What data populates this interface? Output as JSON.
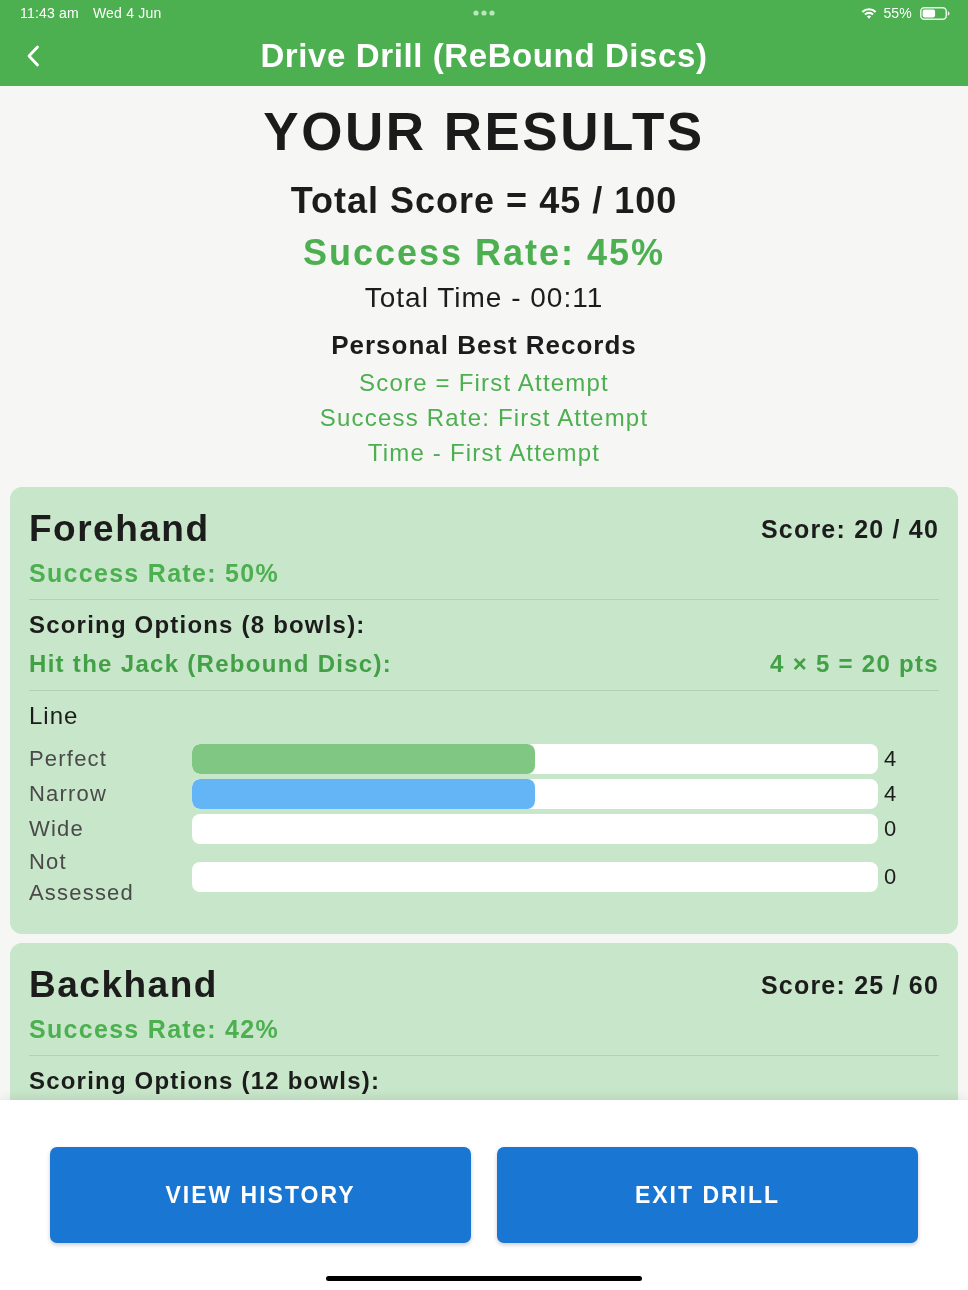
{
  "status_bar": {
    "time": "11:43 am",
    "date": "Wed 4 Jun",
    "battery": "55%"
  },
  "header": {
    "title": "Drive Drill (ReBound Discs)"
  },
  "results": {
    "heading": "YOUR RESULTS",
    "total_score": "Total Score = 45 / 100",
    "success_rate": "Success Rate: 45%",
    "total_time": "Total Time - 00:11",
    "personal_best": {
      "heading": "Personal Best Records",
      "records": [
        "Score = First Attempt",
        "Success Rate: First Attempt",
        "Time - First Attempt"
      ]
    }
  },
  "sections": [
    {
      "name": "Forehand",
      "score": "Score: 20 / 40",
      "success_rate": "Success Rate: 50%",
      "scoring_heading": "Scoring Options (8 bowls):",
      "scoring_options": [
        {
          "label": "Hit the Jack (Rebound Disc):",
          "points": "4 × 5 = 20 pts"
        }
      ],
      "breakdown": {
        "title": "Line",
        "rows": [
          {
            "label": "Perfect",
            "level": 0.5,
            "color": "#81c784",
            "count": "4"
          },
          {
            "label": "Narrow",
            "level": 0.5,
            "color": "#64b5f6",
            "count": "4"
          },
          {
            "label": "Wide",
            "count": "0"
          },
          {
            "label": "Not Assessed",
            "count": "0"
          }
        ]
      }
    },
    {
      "name": "Backhand",
      "score": "Score: 25 / 60",
      "success_rate": "Success Rate: 42%",
      "scoring_heading": "Scoring Options (12 bowls):"
    }
  ],
  "buttons": [
    {
      "label": "VIEW HISTORY"
    },
    {
      "label": "EXIT DRILL"
    }
  ]
}
